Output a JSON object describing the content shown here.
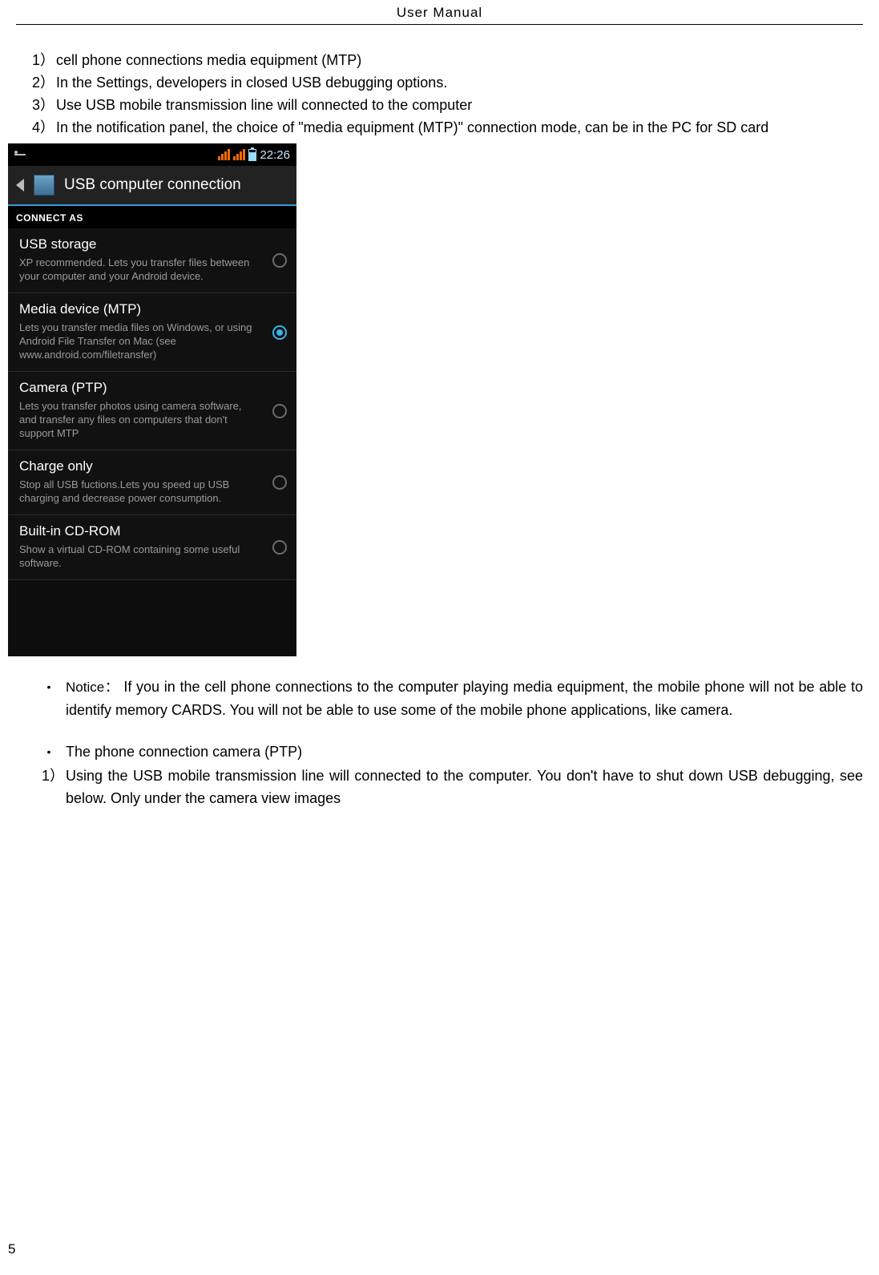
{
  "header": "User    Manual",
  "steps": [
    {
      "n": "1）",
      "t": "cell phone connections media equipment (MTP)"
    },
    {
      "n": "2）",
      "t": "In the Settings, developers in closed USB debugging options."
    },
    {
      "n": "3）",
      "t": "Use USB mobile transmission line will connected to the computer"
    },
    {
      "n": "4）",
      "t": "In the notification panel, the choice of \"media equipment (MTP)\" connection mode, can be in the PC for SD card"
    }
  ],
  "phone": {
    "time": "22:26",
    "title": "USB computer connection",
    "section": "CONNECT AS",
    "options": [
      {
        "title": "USB storage",
        "desc": "XP recommended. Lets you transfer files between your computer and your Android device.",
        "selected": false
      },
      {
        "title": "Media device (MTP)",
        "desc": "Lets you transfer media files on Windows, or using Android File Transfer on Mac (see www.android.com/filetransfer)",
        "selected": true
      },
      {
        "title": "Camera (PTP)",
        "desc": "Lets you transfer photos using camera software, and transfer any files on computers that don't support MTP",
        "selected": false
      },
      {
        "title": "Charge only",
        "desc": "Stop all USB fuctions.Lets you speed up USB charging and decrease power consumption.",
        "selected": false
      },
      {
        "title": "Built-in CD-ROM",
        "desc": "Show a virtual CD-ROM containing some useful software.",
        "selected": false
      }
    ]
  },
  "notice_label": "Notice：",
  "notice_text": "If you in the cell phone connections to the computer playing media equipment, the mobile phone will not be able to identify memory CARDS. You will not be able to use some of the mobile phone applications, like camera.",
  "ptp_bullet": "The   phone connection camera (PTP)",
  "ptp_step_n": "1）",
  "ptp_step_t": "Using the USB mobile transmission line will connected to the computer. You don't have to shut down USB debugging, see below. Only under the camera view images",
  "page_number": "5"
}
